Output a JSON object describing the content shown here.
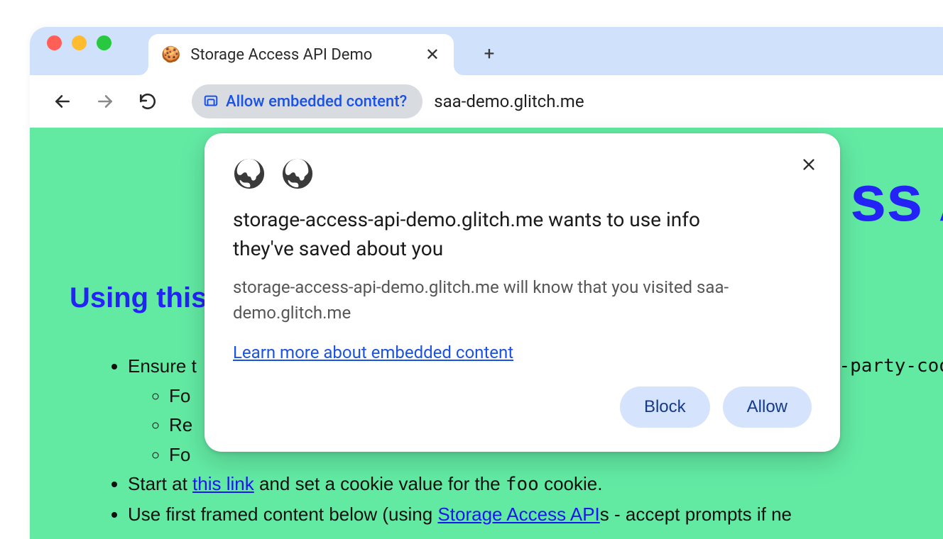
{
  "tab": {
    "favicon": "🍪",
    "title": "Storage Access API Demo",
    "close_glyph": "✕",
    "new_tab_glyph": "+"
  },
  "toolbar": {
    "permission_chip_label": "Allow embedded content?",
    "url": "saa-demo.glitch.me"
  },
  "page": {
    "title_fragment": "ss A",
    "h2": "Using this",
    "list": {
      "li1": "Ensure t",
      "li1a": "Fo",
      "li1b": "Re",
      "li1c": "Fo",
      "li1_right_code": "-party-coo",
      "li2_pre": "Start at ",
      "li2_link": "this link",
      "li2_post_1": " and set a cookie value for the ",
      "li2_code": "foo",
      "li2_post_2": " cookie.",
      "li3_pre": "Use first framed content below (using ",
      "li3_link": "Storage Access API",
      "li3_post": "s - accept prompts if ne"
    }
  },
  "popup": {
    "heading": "storage-access-api-demo.glitch.me wants to use info they've saved about you",
    "body": "storage-access-api-demo.glitch.me will know that you visited saa-demo.glitch.me",
    "learn_more": "Learn more about embedded content",
    "block": "Block",
    "allow": "Allow",
    "close_glyph": "✕"
  },
  "colors": {
    "accent_blue": "#1a52e6",
    "page_green": "#62eaa3",
    "tabstrip": "#d0e1fc",
    "heading_blue": "#2323f5",
    "pill_bg": "#d5e3fc"
  }
}
